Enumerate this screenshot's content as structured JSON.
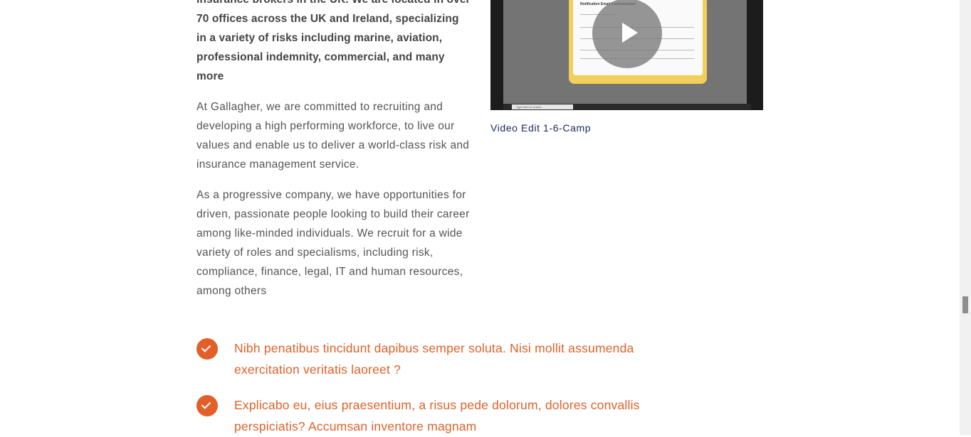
{
  "content": {
    "intro_bold": "insurance brokers in the UK. We are located in over 70 offices across the UK and Ireland, specializing in a variety of risks including marine, aviation, professional indemnity, commercial, and many more",
    "paragraph_1": "At Gallagher, we are committed to recruiting and developing a high performing workforce, to live our values and enable us to deliver a world-class risk and insurance management service.",
    "paragraph_2": "As a progressive company, we have opportunities for driven, passionate people looking to build their career among like-minded individuals. We recruit for a wide variety of roles and specialisms, including risk, compliance, finance, legal, IT and human resources, among others"
  },
  "video": {
    "caption": "Video Edit 1-6-Camp",
    "play_icon": "play-icon",
    "screen_title": "Notification Email Customization",
    "taskbar_search": "Type here to search"
  },
  "checklist": [
    {
      "icon": "checkmark-icon",
      "text": "Nibh penatibus tincidunt dapibus semper soluta. Nisi mollit assumenda exercitation veritatis laoreet ?"
    },
    {
      "icon": "checkmark-icon",
      "text": "Explicabo eu, eius praesentium, a risus pede dolorum, dolores convallis perspiciatis? Accumsan inventore magnam"
    }
  ],
  "colors": {
    "accent_orange": "#e35f2a",
    "caption_navy": "#1a2a55",
    "body_text": "#555555"
  }
}
